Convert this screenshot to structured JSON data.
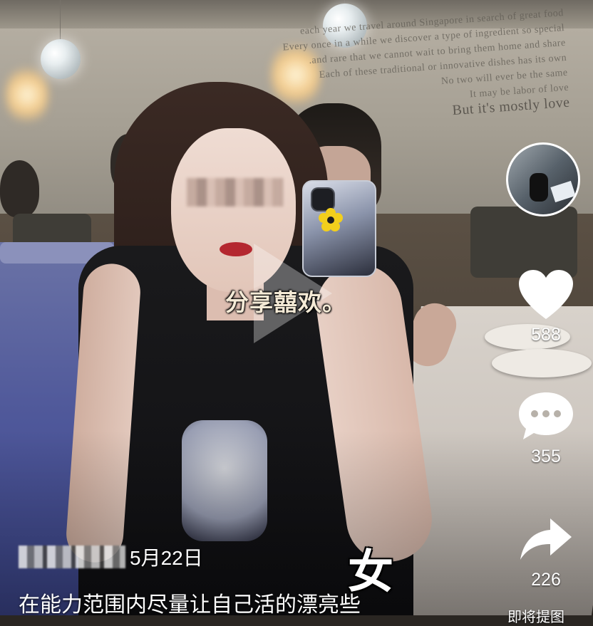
{
  "video": {
    "center_caption": "分享囍欢。",
    "overlay_chars": [
      "女"
    ]
  },
  "author": {
    "name_masked": "",
    "date": "5月22日",
    "description": "在能力范围内尽量让自己活的漂亮些"
  },
  "actions": {
    "likes": "588",
    "comments": "355",
    "shares": "226"
  },
  "footer": {
    "partial_text": "即将提图"
  },
  "wall_text": [
    "each year we travel around Singapore in search of great food",
    "Every once in a while we discover a type of ingredient so special",
    "and rare that we cannot wait to bring them home and share.",
    "Each of these traditional or innovative dishes has its own",
    "No two will ever be the same",
    "It may be labor of love",
    "But it's mostly love"
  ],
  "colors": {
    "overlay_text": "#ffffff",
    "caption_text": "#f4ead6",
    "lips": "#b4272f"
  }
}
